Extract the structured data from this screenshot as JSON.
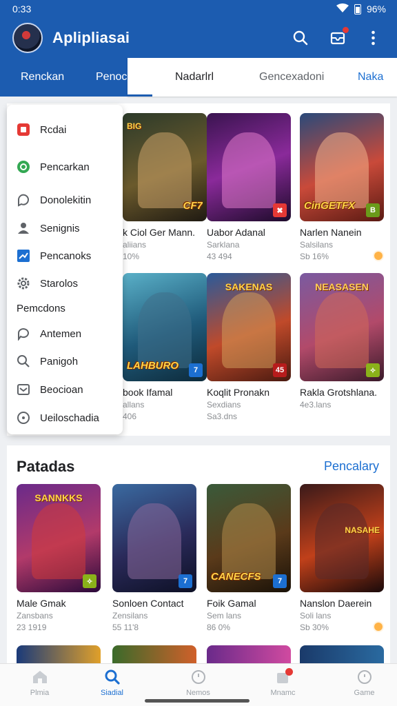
{
  "status": {
    "time": "0:33",
    "battery": "96%"
  },
  "app": {
    "title": "Aplipliasai"
  },
  "tabs": [
    {
      "label": "Renckan"
    },
    {
      "label": "Penocia"
    },
    {
      "label": "Nadarlrl"
    },
    {
      "label": "Gencexadoni"
    },
    {
      "label": "Naka"
    }
  ],
  "drawer": {
    "items": [
      {
        "label": "Rcdai",
        "icon": "red-square-icon"
      },
      {
        "label": "Pencarkan",
        "icon": "green-circle-icon"
      },
      {
        "label": "Donolekitin",
        "icon": "chat-icon"
      },
      {
        "label": "Senignis",
        "icon": "person-icon"
      },
      {
        "label": "Pencanoks",
        "icon": "chart-icon"
      },
      {
        "label": "Starolos",
        "icon": "gear-icon"
      },
      {
        "label": "Pemcdons",
        "icon": ""
      },
      {
        "label": "Antemen",
        "icon": "comment-icon"
      },
      {
        "label": "Panigoh",
        "icon": "search-icon"
      },
      {
        "label": "Beocioan",
        "icon": "inbox-icon"
      },
      {
        "label": "Ueiloschadia",
        "icon": "info-icon"
      }
    ]
  },
  "grid1": [
    {
      "title": "k Ciol Ger Mann.",
      "sub": "aliians",
      "meta": "10%",
      "cap": "CF7",
      "top": "BIG",
      "corner": ""
    },
    {
      "title": "Uabor Adanal",
      "sub": "Sarklana",
      "meta": "43 494",
      "cap": "",
      "top": "",
      "corner": "✖"
    },
    {
      "title": "Narlen Nanein",
      "sub": "Salsilans",
      "meta": "Sb 16%",
      "cap": "CinGETFX",
      "top": "",
      "corner": "B"
    },
    {
      "title": "book Ifamal",
      "sub": "allans",
      "meta": "406",
      "cap": "LAHBURO",
      "top": "",
      "corner": "7"
    },
    {
      "title": "Koqlit Pronakn",
      "sub": "Sexdians",
      "meta": "Sa3.dns",
      "cap": "",
      "top": "SAKENAS",
      "corner": "45"
    },
    {
      "title": "Rakla Grotshlana.",
      "sub": "4e3.lans",
      "meta": "",
      "cap": "",
      "top": "NEASASEN",
      "corner": "✧"
    }
  ],
  "section2": {
    "title": "Patadas",
    "link": "Pencalary",
    "cards": [
      {
        "title": "Male Gmak",
        "sub": "Zansbans",
        "meta": "23 1919",
        "cap": "",
        "top": "SANNKKS",
        "corner": "✧"
      },
      {
        "title": "Sonloen Contact",
        "sub": "Zensilans",
        "meta": "55 11'8",
        "cap": "",
        "top": "",
        "corner": "7"
      },
      {
        "title": "Foik Gamal",
        "sub": "Sem lans",
        "meta": "86 0%",
        "cap": "CANECFS",
        "top": "",
        "corner": "7"
      },
      {
        "title": "Nanslon Daerein",
        "sub": "Soli lans",
        "meta": "Sb 30%",
        "cap": "",
        "top": "NASAHE",
        "corner": ""
      }
    ]
  },
  "bottomnav": [
    {
      "label": "Plmia",
      "icon": "home-icon"
    },
    {
      "label": "Siadial",
      "icon": "search-icon"
    },
    {
      "label": "Nemos",
      "icon": "clock-icon"
    },
    {
      "label": "Mnamc",
      "icon": "bag-icon"
    },
    {
      "label": "Game",
      "icon": "game-icon"
    }
  ],
  "colors": {
    "primary": "#1c5cb0",
    "accent": "#1c6fd1"
  }
}
